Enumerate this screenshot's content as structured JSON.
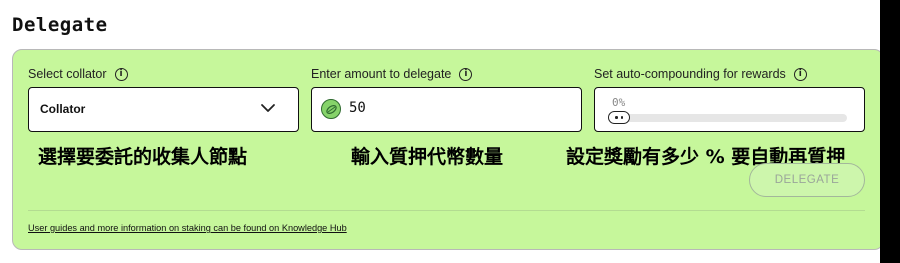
{
  "page": {
    "title": "Delegate"
  },
  "collator": {
    "label": "Select collator",
    "value": "Collator",
    "annotation": "選擇要委託的收集人節點"
  },
  "amount": {
    "label": "Enter amount to delegate",
    "value": "50",
    "annotation": "輸入質押代幣數量"
  },
  "auto_compounding": {
    "label": "Set auto-compounding for rewards",
    "percent_text": "0%",
    "value_percent": 0,
    "annotation": "設定獎勵有多少 % 要自動再質押"
  },
  "actions": {
    "delegate_label": "DELEGATE"
  },
  "footer": {
    "link_text": "User guides and more information on staking can be found on Knowledge Hub"
  },
  "icons": {
    "info": "i"
  },
  "colors": {
    "card_background": "#c6f79b",
    "token_green": "#86d36a",
    "button_disabled_text": "#9aa59a"
  }
}
